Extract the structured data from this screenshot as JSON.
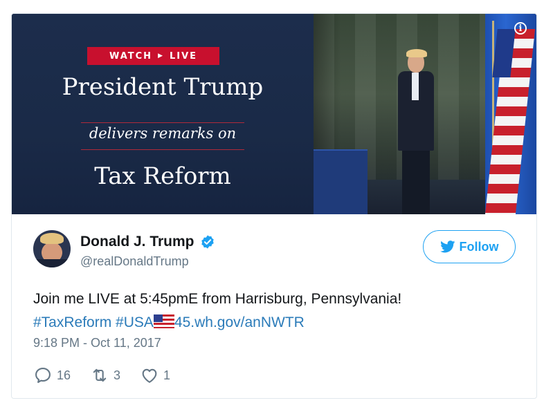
{
  "media": {
    "badge_watch": "WATCH",
    "badge_arrow": "▶",
    "badge_live": "LIVE",
    "headline": "President Trump",
    "subhead": "delivers remarks on",
    "topic": "Tax Reform",
    "info_glyph": "i"
  },
  "author": {
    "display_name": "Donald J. Trump",
    "handle": "@realDonaldTrump",
    "verified": true
  },
  "follow_button": {
    "label": "Follow"
  },
  "tweet": {
    "text": "Join me LIVE at 5:45pmE from Harrisburg, Pennsylvania!",
    "hashtag_1": "#TaxReform",
    "hashtag_2": "#USA",
    "flag_emoji": "us-flag-emoji",
    "link": "45.wh.gov/anNWTR",
    "timestamp": "9:18 PM - Oct 11, 2017"
  },
  "actions": {
    "replies": "16",
    "retweets": "3",
    "likes": "1"
  },
  "colors": {
    "link_blue": "#2b7bb9",
    "twitter_blue": "#1da1f2",
    "badge_red": "#c8102e",
    "media_navy": "#1c2d4c",
    "muted_text": "#657786"
  }
}
